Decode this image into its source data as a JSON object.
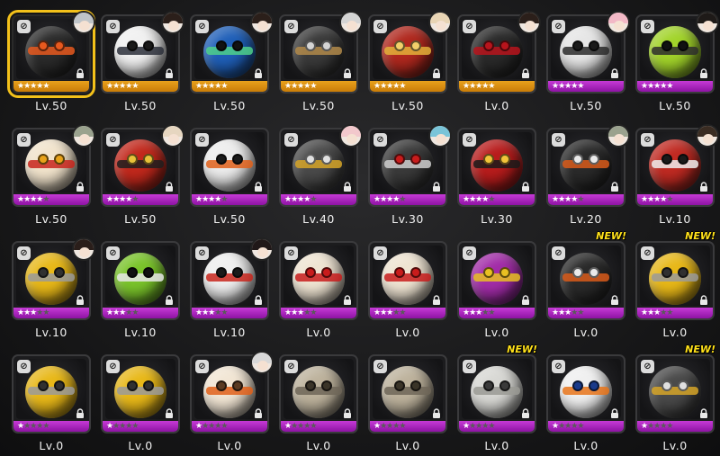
{
  "cards": [
    {
      "level": "Lv.50",
      "stars": 5,
      "rarity": "gold",
      "color": "#2b2b2b",
      "band": "#e8591e",
      "eye": "#e8591e",
      "avatar": "#bfc4c8",
      "selected": true,
      "new": false,
      "type": "⊘"
    },
    {
      "level": "Lv.50",
      "stars": 5,
      "rarity": "gold",
      "color": "#f1f1f1",
      "band": "#2b2f3a",
      "eye": "#1a1a1a",
      "avatar": "#2b1f1a",
      "selected": false,
      "new": false,
      "type": "⊘"
    },
    {
      "level": "Lv.50",
      "stars": 5,
      "rarity": "gold",
      "color": "#1f5fb8",
      "band": "#4fd08a",
      "eye": "#121212",
      "avatar": "#2b1f1a",
      "selected": false,
      "new": false,
      "type": "⊘"
    },
    {
      "level": "Lv.50",
      "stars": 5,
      "rarity": "gold",
      "color": "#3a3a3a",
      "band": "#b28a4a",
      "eye": "#d4d4d4",
      "avatar": "#d4d4d4",
      "selected": false,
      "new": false,
      "type": "⊘"
    },
    {
      "level": "Lv.50",
      "stars": 5,
      "rarity": "gold",
      "color": "#b0281e",
      "band": "#e3b23a",
      "eye": "#f2d06a",
      "avatar": "#e8d4b4",
      "selected": false,
      "new": false,
      "type": "⊘"
    },
    {
      "level": "Lv.0",
      "stars": 5,
      "rarity": "gold",
      "color": "#2a2a2a",
      "band": "#b8141c",
      "eye": "#b8141c",
      "avatar": "#2b1f1a",
      "selected": false,
      "new": false,
      "type": "⊘"
    },
    {
      "level": "Lv.50",
      "stars": 5,
      "rarity": "purple",
      "color": "#e6e6e6",
      "band": "#2a2a2a",
      "eye": "#1a1a1a",
      "avatar": "#f2b8c6",
      "selected": false,
      "new": false,
      "type": "⊘"
    },
    {
      "level": "Lv.50",
      "stars": 5,
      "rarity": "purple",
      "color": "#a2d42a",
      "band": "#2d2d2d",
      "eye": "#111111",
      "avatar": "#1e1a18",
      "selected": false,
      "new": false,
      "type": "⊘"
    },
    {
      "level": "Lv.50",
      "stars": 4,
      "rarity": "purple",
      "color": "#f2e4cc",
      "band": "#c8241c",
      "eye": "#e8a21a",
      "avatar": "#9aa28e",
      "selected": false,
      "new": false,
      "type": "⊘"
    },
    {
      "level": "Lv.50",
      "stars": 4,
      "rarity": "purple",
      "color": "#c2281c",
      "band": "#1e1e1e",
      "eye": "#e8c23a",
      "avatar": "#e6d6c0",
      "selected": false,
      "new": false,
      "type": "⊘"
    },
    {
      "level": "Lv.50",
      "stars": 4,
      "rarity": "purple",
      "color": "#ededed",
      "band": "#e0601a",
      "eye": "#1a1a1a",
      "avatar": "",
      "selected": false,
      "new": false,
      "type": "⊘"
    },
    {
      "level": "Lv.40",
      "stars": 4,
      "rarity": "purple",
      "color": "#4a4a4a",
      "band": "#d6a528",
      "eye": "#e0e0e0",
      "avatar": "#f2c8cc",
      "selected": false,
      "new": false,
      "type": "⊘"
    },
    {
      "level": "Lv.30",
      "stars": 4,
      "rarity": "purple",
      "color": "#3a3a3a",
      "band": "#cfcfcf",
      "eye": "#c81c1c",
      "avatar": "#7ac4d8",
      "selected": false,
      "new": false,
      "type": "⊘"
    },
    {
      "level": "Lv.30",
      "stars": 4,
      "rarity": "purple",
      "color": "#b81c1c",
      "band": "#1a1a1a",
      "eye": "#f2c43a",
      "avatar": "",
      "selected": false,
      "new": false,
      "type": "⊘"
    },
    {
      "level": "Lv.20",
      "stars": 4,
      "rarity": "purple",
      "color": "#2a2a2a",
      "band": "#d85a1a",
      "eye": "#eaeaea",
      "avatar": "#9aa28e",
      "selected": false,
      "new": false,
      "type": "⊘"
    },
    {
      "level": "Lv.10",
      "stars": 4,
      "rarity": "purple",
      "color": "#c02a22",
      "band": "#efefef",
      "eye": "#1a1a1a",
      "avatar": "#3a2c22",
      "selected": false,
      "new": false,
      "type": "⊘"
    },
    {
      "level": "Lv.10",
      "stars": 3,
      "rarity": "purple",
      "color": "#e8b818",
      "band": "#9a9a9a",
      "eye": "#303030",
      "avatar": "#2a1e1a",
      "selected": false,
      "new": false,
      "type": "⊘"
    },
    {
      "level": "Lv.10",
      "stars": 3,
      "rarity": "purple",
      "color": "#7ac42a",
      "band": "#e8e8e8",
      "eye": "#111111",
      "avatar": "",
      "selected": false,
      "new": false,
      "type": "⊘"
    },
    {
      "level": "Lv.10",
      "stars": 3,
      "rarity": "purple",
      "color": "#efefef",
      "band": "#c8261c",
      "eye": "#1a1a1a",
      "avatar": "#201818",
      "selected": false,
      "new": false,
      "type": "⊘"
    },
    {
      "level": "Lv.0",
      "stars": 3,
      "rarity": "purple",
      "color": "#efe4d2",
      "band": "#c81c1c",
      "eye": "#c81c1c",
      "avatar": "",
      "selected": false,
      "new": false,
      "type": "⊘"
    },
    {
      "level": "Lv.0",
      "stars": 3,
      "rarity": "purple",
      "color": "#efe4d2",
      "band": "#c81c1c",
      "eye": "#c81c1c",
      "avatar": "",
      "selected": false,
      "new": false,
      "type": "⊘"
    },
    {
      "level": "Lv.0",
      "stars": 3,
      "rarity": "purple",
      "color": "#a22ca8",
      "band": "#e8c022",
      "eye": "#e8c022",
      "avatar": "",
      "selected": false,
      "new": false,
      "type": "⊘"
    },
    {
      "level": "Lv.0",
      "stars": 3,
      "rarity": "purple",
      "color": "#2a2a2a",
      "band": "#d85a1a",
      "eye": "#eaeaea",
      "avatar": "",
      "selected": false,
      "new": true,
      "type": "⊘"
    },
    {
      "level": "Lv.0",
      "stars": 3,
      "rarity": "purple",
      "color": "#e8b818",
      "band": "#9a9a9a",
      "eye": "#303030",
      "avatar": "",
      "selected": false,
      "new": true,
      "type": "⊘"
    },
    {
      "level": "Lv.0",
      "stars": 1,
      "rarity": "purple",
      "color": "#e8b818",
      "band": "#9a9a9a",
      "eye": "#303030",
      "avatar": "",
      "selected": false,
      "new": false,
      "type": "⊘"
    },
    {
      "level": "Lv.0",
      "stars": 1,
      "rarity": "purple",
      "color": "#e8b818",
      "band": "#9a9a9a",
      "eye": "#303030",
      "avatar": "",
      "selected": false,
      "new": false,
      "type": "⊘"
    },
    {
      "level": "Lv.0",
      "stars": 1,
      "rarity": "purple",
      "color": "#f2e6d4",
      "band": "#e0601a",
      "eye": "#5a3a22",
      "avatar": "#d8d8d8",
      "selected": false,
      "new": false,
      "type": "⊘"
    },
    {
      "level": "Lv.0",
      "stars": 1,
      "rarity": "purple",
      "color": "#bdb29c",
      "band": "#6e6658",
      "eye": "#3a3428",
      "avatar": "",
      "selected": false,
      "new": false,
      "type": "⊘"
    },
    {
      "level": "Lv.0",
      "stars": 1,
      "rarity": "purple",
      "color": "#bdb29c",
      "band": "#6e6658",
      "eye": "#3a3428",
      "avatar": "",
      "selected": false,
      "new": false,
      "type": "⊘"
    },
    {
      "level": "Lv.0",
      "stars": 1,
      "rarity": "purple",
      "color": "#d8d8d4",
      "band": "#9a9a94",
      "eye": "#3a3a3a",
      "avatar": "",
      "selected": false,
      "new": true,
      "type": "⊘"
    },
    {
      "level": "Lv.0",
      "stars": 1,
      "rarity": "purple",
      "color": "#f0f0f0",
      "band": "#e8741a",
      "eye": "#1a3a8a",
      "avatar": "",
      "selected": false,
      "new": false,
      "type": "⊘"
    },
    {
      "level": "Lv.0",
      "stars": 1,
      "rarity": "purple",
      "color": "#4a4a4a",
      "band": "#d6a528",
      "eye": "#e0e0e0",
      "avatar": "",
      "selected": false,
      "new": true,
      "type": "⊘"
    }
  ],
  "labels": {
    "new": "NEW!",
    "star": "★"
  },
  "icons": {
    "type": "no-entry-icon",
    "lock": "lock-icon"
  }
}
